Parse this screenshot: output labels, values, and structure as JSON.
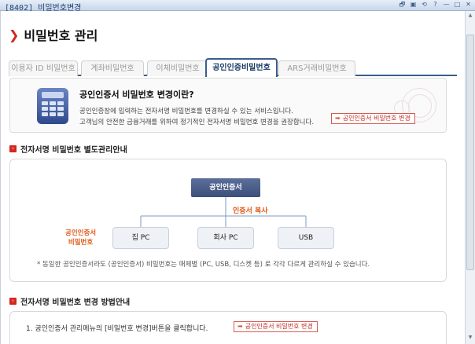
{
  "window": {
    "title": "[8402] 비밀번호변경",
    "controls": [
      "🗗",
      "▣",
      "⟲",
      "?",
      "—",
      "□",
      "✕"
    ]
  },
  "page": {
    "title": "비밀번호 관리"
  },
  "tabs": [
    {
      "label": "이용자 ID 비밀번호",
      "active": false
    },
    {
      "label": "계좌비밀번호",
      "active": false
    },
    {
      "label": "이체비밀번호",
      "active": false
    },
    {
      "label": "공인인증비밀번호",
      "active": true
    },
    {
      "label": "ARS거래비밀번호",
      "active": false
    }
  ],
  "intro": {
    "question": "공인인증서 비밀번호 변경이란?",
    "desc1": "공인인증창에 입력하는 전자서명 비밀번호를 변경하실 수 있는 서비스입니다.",
    "desc2": "고객님의 안전한 금융거래를 위하여 정기적인 전자서명 비밀번호 변경을 권장합니다.",
    "button": "공인인증서 비밀번호 변경"
  },
  "section1": {
    "title": "전자서명 비밀번호 별도관리안내",
    "cert_label": "공인인증서",
    "copy_label": "인증서 복사",
    "left_label_1": "공인인증서",
    "left_label_2": "비밀번호",
    "devices": [
      "집 PC",
      "회사 PC",
      "USB"
    ],
    "note": "* 동일한 공인인증서라도 (공인인증서) 비밀번호는 매체별 (PC, USB, 디스켓 등) 로 각각 다르게 관리하실 수 있습니다."
  },
  "section2": {
    "title": "전자서명 비밀번호 변경 방법안내",
    "step1": "1. 공인인증서 관리메뉴의 [비밀번호 변경]버튼을 클릭합니다.",
    "button": "공인인증서 비밀번호 변경"
  },
  "colors": {
    "accent_red": "#d3241f",
    "tab_active": "#3b5e8a",
    "orange_label": "#e05a1a"
  },
  "icons": {
    "title_chevron": "chevron-right-icon",
    "calculator": "calculator-icon",
    "button_arrow": "arrow-right-icon",
    "section_bullet": "square-bullet-icon"
  }
}
